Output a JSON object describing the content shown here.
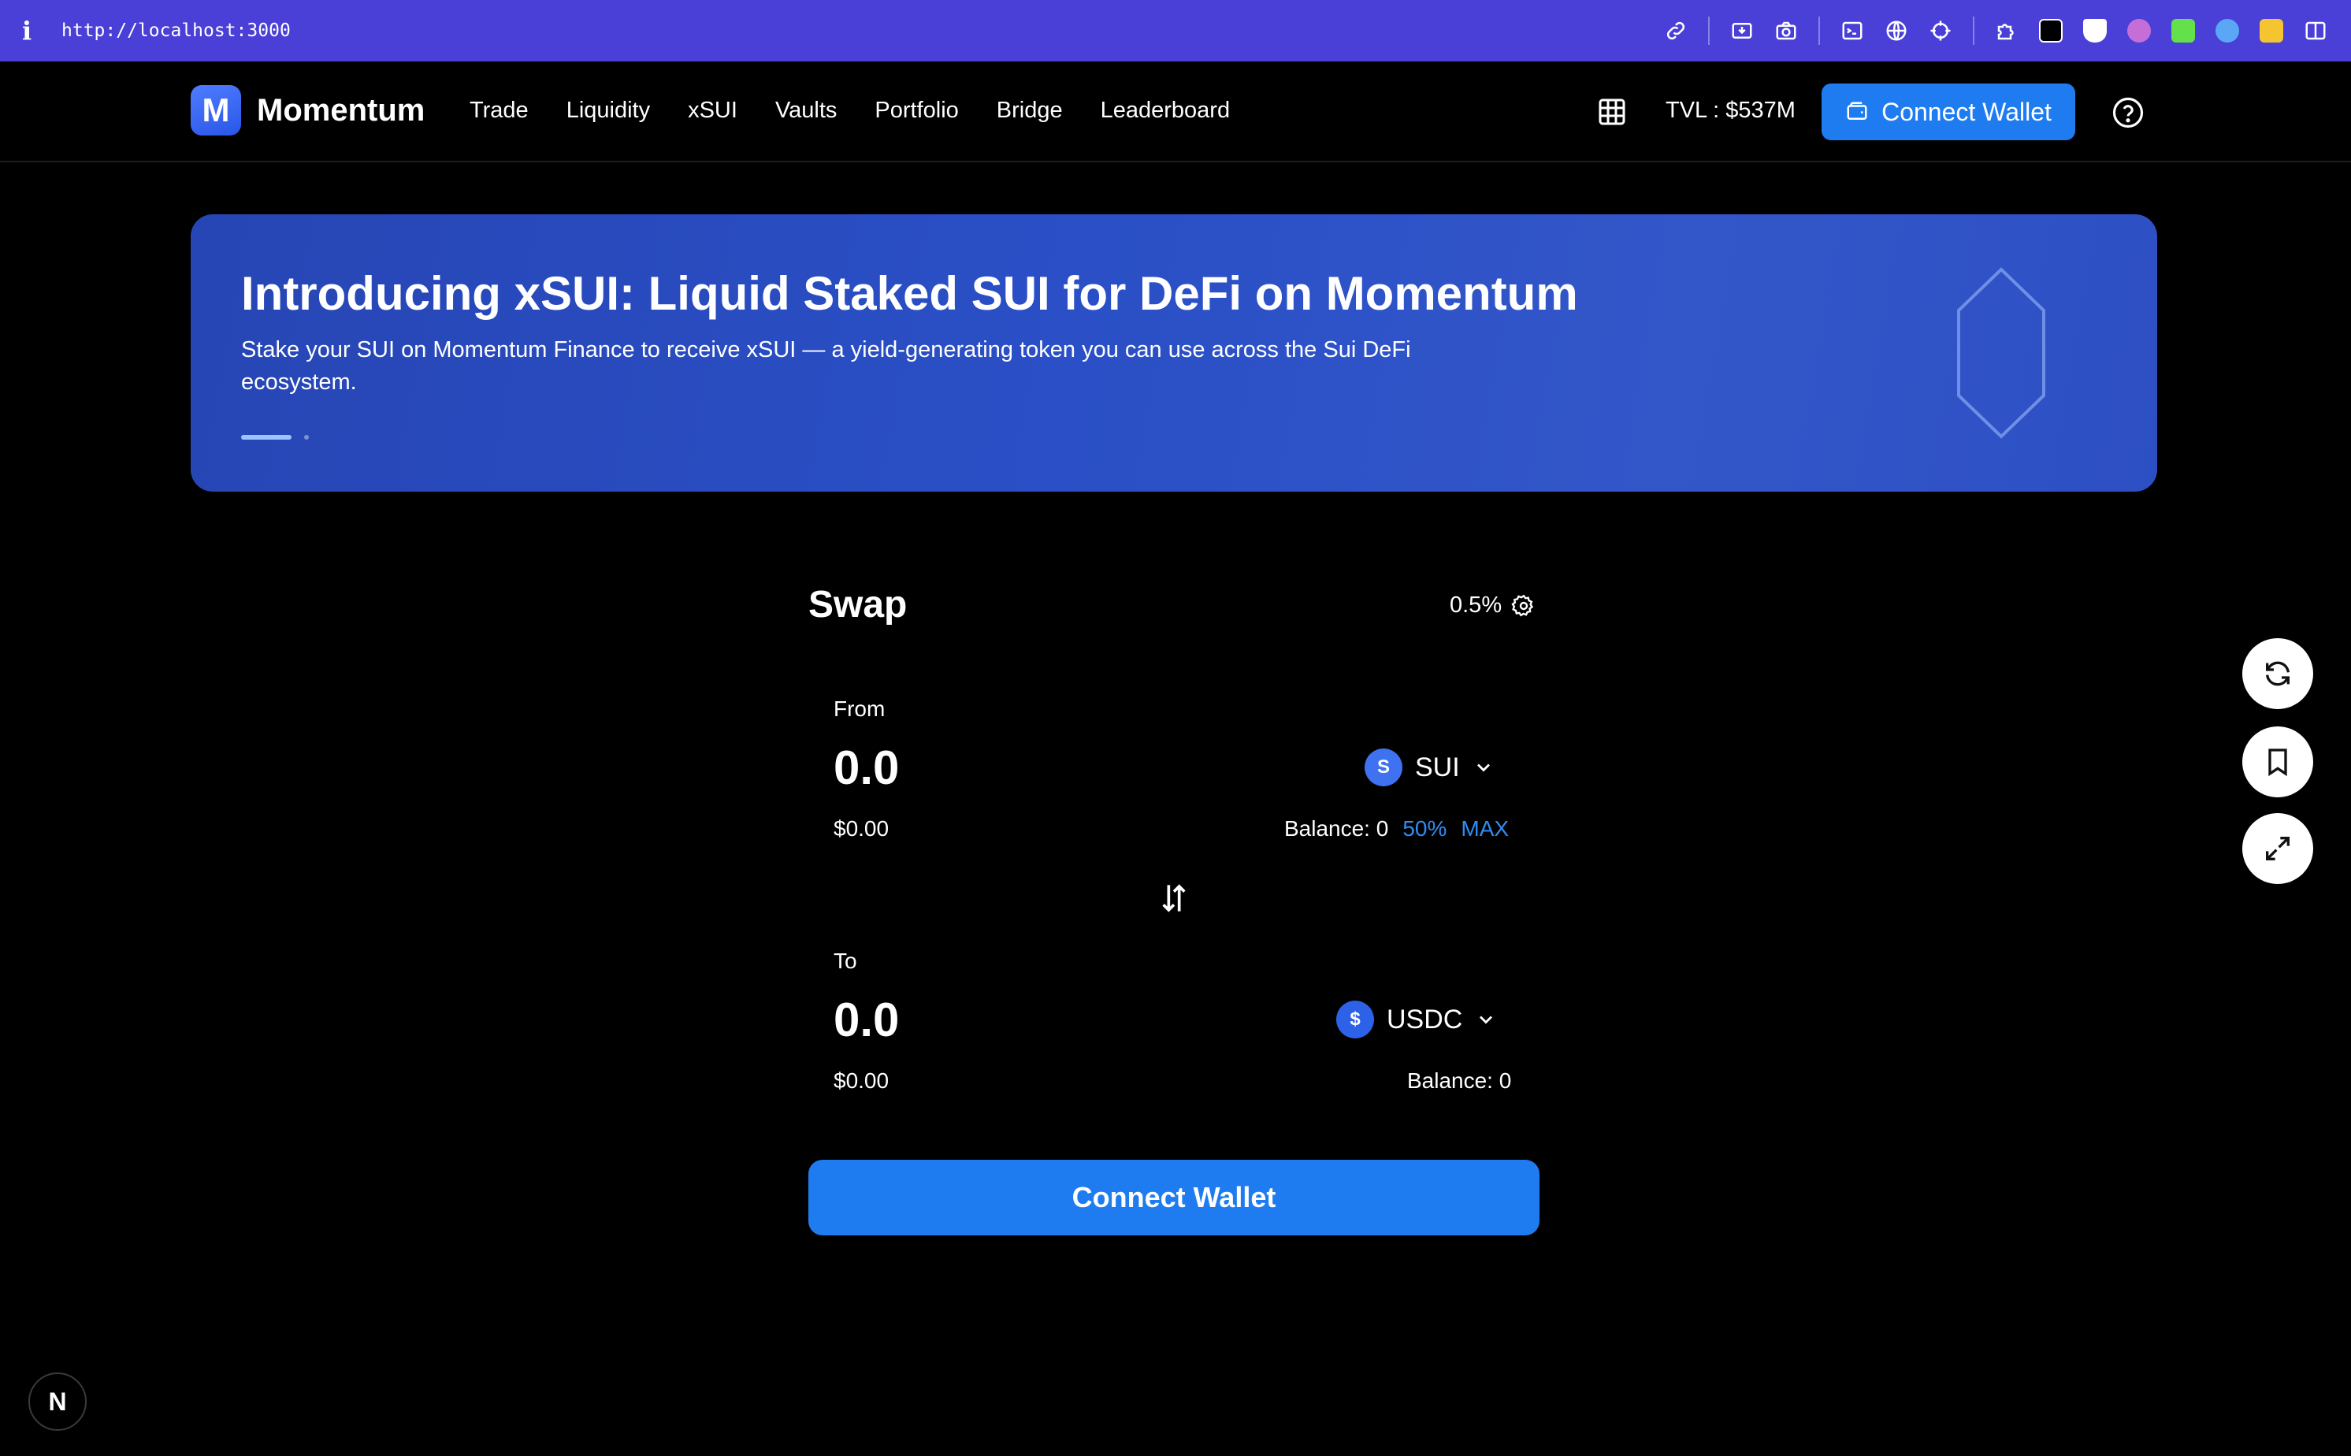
{
  "browser": {
    "info_glyph": "i",
    "url": "http://localhost:3000"
  },
  "header": {
    "logo_letter": "M",
    "brand": "Momentum",
    "nav": [
      "Trade",
      "Liquidity",
      "xSUI",
      "Vaults",
      "Portfolio",
      "Bridge",
      "Leaderboard"
    ],
    "tvl": "TVL : $537M",
    "connect_label": "Connect Wallet"
  },
  "banner": {
    "title": "Introducing xSUI: Liquid Staked SUI for DeFi on Momentum",
    "description": "Stake your SUI on Momentum Finance to receive xSUI — a yield-generating token you can use across the Sui DeFi ecosystem.",
    "slides": 2,
    "active_slide": 1
  },
  "swap": {
    "title": "Swap",
    "slippage": "0.5%",
    "from": {
      "label": "From",
      "amount": "0.0",
      "usd": "$0.00",
      "token_symbol": "SUI",
      "token_icon_letter": "S",
      "balance": "Balance: 0",
      "pct_50": "50%",
      "max": "MAX"
    },
    "to": {
      "label": "To",
      "amount": "0.0",
      "usd": "$0.00",
      "token_symbol": "USDC",
      "token_icon_letter": "$",
      "balance": "Balance: 0"
    },
    "connect_label": "Connect Wallet"
  },
  "colors": {
    "accent": "#1f7cf0",
    "browser_bar": "#4a3fd6",
    "banner": "#2a4fc6",
    "link": "#2f8cf5"
  },
  "icons": [
    "grid-icon",
    "wallet-icon",
    "help-icon",
    "gear-icon",
    "chevron-down-icon",
    "swap-direction-icon",
    "refresh-icon",
    "bookmark-icon",
    "expand-icon"
  ],
  "next_badge": "N"
}
